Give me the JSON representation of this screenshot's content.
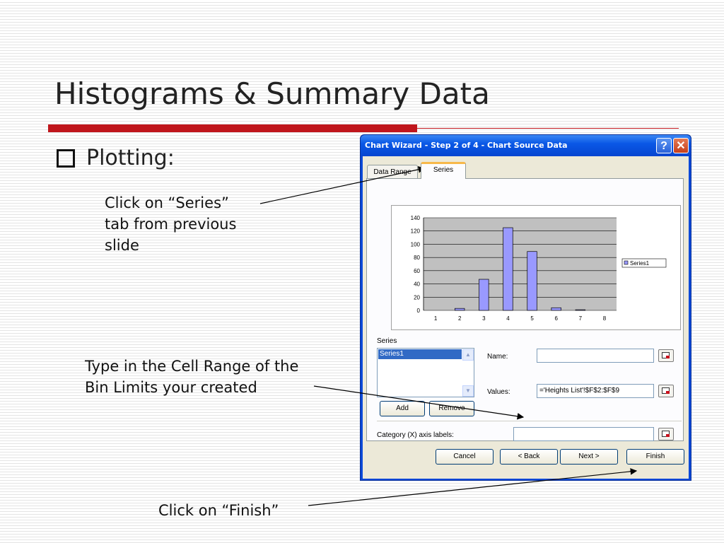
{
  "slide": {
    "title": "Histograms & Summary Data",
    "bullet": "Plotting:",
    "note_series_1": "Click on “Series”",
    "note_series_2": "tab from previous",
    "note_series_3": "slide",
    "note_range_1": "Type in the Cell Range of the",
    "note_range_2": "Bin Limits your created",
    "note_finish": "Click on “Finish”",
    "accent_color": "#c0161c"
  },
  "dialog": {
    "title": "Chart Wizard - Step 2 of 4 - Chart Source Data",
    "help_label": "?",
    "close_label": "✕",
    "tabs": [
      {
        "label": "Data Range"
      },
      {
        "label": "Series",
        "selected": true
      }
    ],
    "series_section_label": "Series",
    "series_list": [
      "Series1"
    ],
    "name_label": "Name:",
    "name_value": "",
    "values_label": "Values:",
    "values_value": "='Heights List'!$F$2:$F$9",
    "add_label": "Add",
    "remove_label": "Remove",
    "category_label": "Category (X) axis labels:",
    "category_value": "",
    "buttons": {
      "cancel": "Cancel",
      "back": "< Back",
      "next": "Next >",
      "finish": "Finish"
    },
    "titlebar_color": "#0a58e6"
  },
  "chart_data": {
    "type": "bar",
    "categories": [
      "1",
      "2",
      "3",
      "4",
      "5",
      "6",
      "7",
      "8"
    ],
    "series": [
      {
        "name": "Series1",
        "values": [
          0,
          3,
          47,
          125,
          89,
          4,
          1,
          0
        ]
      }
    ],
    "y_ticks": [
      "0",
      "20",
      "40",
      "60",
      "80",
      "100",
      "120",
      "140"
    ],
    "ylim": [
      0,
      140
    ],
    "grid": true,
    "legend": "right",
    "bar_color": "#9999ff",
    "plot_bg": "#c0c0c0"
  }
}
